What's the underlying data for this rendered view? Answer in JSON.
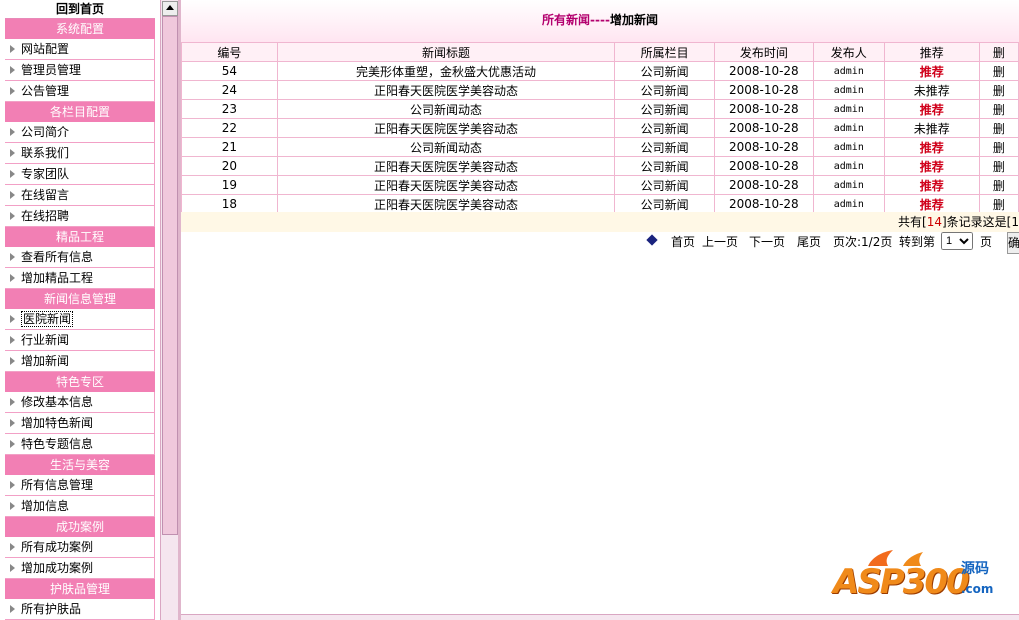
{
  "sidebar": {
    "home": "回到首页",
    "sections": [
      {
        "title": "系统配置",
        "items": [
          "网站配置",
          "管理员管理",
          "公告管理"
        ]
      },
      {
        "title": "各栏目配置",
        "items": [
          "公司简介",
          "联系我们",
          "专家团队",
          "在线留言",
          "在线招聘"
        ]
      },
      {
        "title": "精品工程",
        "items": [
          "查看所有信息",
          "增加精品工程"
        ]
      },
      {
        "title": "新闻信息管理",
        "items": [
          "医院新闻",
          "行业新闻",
          "增加新闻"
        ]
      },
      {
        "title": "特色专区",
        "items": [
          "修改基本信息",
          "增加特色新闻",
          "特色专题信息"
        ]
      },
      {
        "title": "生活与美容",
        "items": [
          "所有信息管理",
          "增加信息"
        ]
      },
      {
        "title": "成功案例",
        "items": [
          "所有成功案例",
          "增加成功案例"
        ]
      },
      {
        "title": "护肤品管理",
        "items": [
          "所有护肤品"
        ]
      }
    ]
  },
  "header": {
    "title_link": "所有新闻",
    "separator": "----",
    "title_add": "增加新闻"
  },
  "table": {
    "columns": [
      "编号",
      "新闻标题",
      "所属栏目",
      "发布时间",
      "发布人",
      "推荐",
      "删"
    ],
    "rows": [
      {
        "id": "54",
        "title": "完美形体重塑，金秋盛大优惠活动",
        "category": "公司新闻",
        "date": "2008-10-28",
        "publisher": "admin",
        "recommend": "推荐",
        "action": "删"
      },
      {
        "id": "24",
        "title": "正阳春天医院医学美容动态",
        "category": "公司新闻",
        "date": "2008-10-28",
        "publisher": "admin",
        "recommend": "未推荐",
        "action": "删"
      },
      {
        "id": "23",
        "title": "公司新闻动态",
        "category": "公司新闻",
        "date": "2008-10-28",
        "publisher": "admin",
        "recommend": "推荐",
        "action": "删"
      },
      {
        "id": "22",
        "title": "正阳春天医院医学美容动态",
        "category": "公司新闻",
        "date": "2008-10-28",
        "publisher": "admin",
        "recommend": "未推荐",
        "action": "删"
      },
      {
        "id": "21",
        "title": "公司新闻动态",
        "category": "公司新闻",
        "date": "2008-10-28",
        "publisher": "admin",
        "recommend": "推荐",
        "action": "删"
      },
      {
        "id": "20",
        "title": "正阳春天医院医学美容动态",
        "category": "公司新闻",
        "date": "2008-10-28",
        "publisher": "admin",
        "recommend": "推荐",
        "action": "删"
      },
      {
        "id": "19",
        "title": "正阳春天医院医学美容动态",
        "category": "公司新闻",
        "date": "2008-10-28",
        "publisher": "admin",
        "recommend": "推荐",
        "action": "删"
      },
      {
        "id": "18",
        "title": "正阳春天医院医学美容动态",
        "category": "公司新闻",
        "date": "2008-10-28",
        "publisher": "admin",
        "recommend": "推荐",
        "action": "删"
      }
    ]
  },
  "summary": {
    "prefix": "共有[",
    "count": "14",
    "suffix": "]条记录这是[1"
  },
  "pager": {
    "first": "首页",
    "prev": "上一页",
    "next": "下一页",
    "last": "尾页",
    "page_info": "页次:1/2页",
    "goto": "转到第",
    "page_value": "1",
    "page_unit": "页",
    "button": "确"
  },
  "logo": {
    "brand": "ASP300",
    "cn": "源码",
    "domain": ".com"
  },
  "colors": {
    "section_bg": "#f27fb4",
    "accent_title": "#b3006e",
    "recommend": "#d0001a"
  }
}
